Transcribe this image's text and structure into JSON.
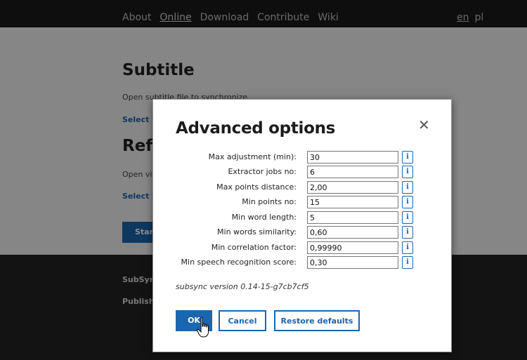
{
  "nav": {
    "items": [
      "About",
      "Online",
      "Download",
      "Contribute",
      "Wiki"
    ],
    "active": "Online",
    "languages": [
      "en",
      "pl"
    ]
  },
  "page": {
    "subtitle_heading": "Subtitle",
    "subtitle_text": "Open subtitle file to synchronize",
    "subtitle_link": "Select fi",
    "reference_heading": "Refe",
    "reference_text": "Open vi",
    "reference_link": "Select fi",
    "start_button": "Start",
    "footer_line1": "SubSync",
    "footer_line2": "Publishe"
  },
  "modal": {
    "title": "Advanced options",
    "close_icon": "close-icon",
    "options": [
      {
        "label": "Max adjustment (min):",
        "value": "30"
      },
      {
        "label": "Extractor jobs no:",
        "value": "6"
      },
      {
        "label": "Max points distance:",
        "value": "2,00"
      },
      {
        "label": "Min points no:",
        "value": "15"
      },
      {
        "label": "Min word length:",
        "value": "5"
      },
      {
        "label": "Min words similarity:",
        "value": "0,60"
      },
      {
        "label": "Min correlation factor:",
        "value": "0,99990"
      },
      {
        "label": "Min speech recognition score:",
        "value": "0,30"
      }
    ],
    "info_label": "i",
    "version": "subsync version 0.14-15-g7cb7cf5",
    "buttons": {
      "ok": "OK",
      "cancel": "Cancel",
      "restore": "Restore defaults"
    }
  },
  "colors": {
    "accent": "#1a66b0",
    "topbar": "#1a1a1a",
    "footer": "#232323"
  }
}
